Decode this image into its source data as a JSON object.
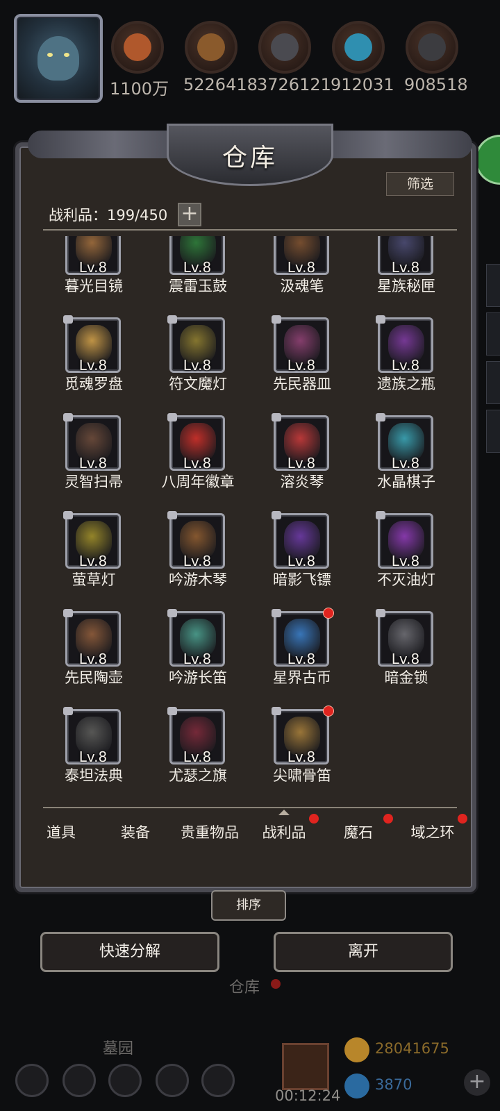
{
  "resources": [
    {
      "icon": "ore-icon",
      "amount": "1100万",
      "color": "#b0582c"
    },
    {
      "icon": "wood-icon",
      "amount": "5226418",
      "color": "#8a5a2c"
    },
    {
      "icon": "iron-icon",
      "amount": "3726121",
      "color": "#4a4a50"
    },
    {
      "icon": "crystal-icon",
      "amount": "912031",
      "color": "#2f8fb0"
    },
    {
      "icon": "steel-icon",
      "amount": "908518",
      "color": "#3c3c40"
    }
  ],
  "panel": {
    "title": "仓库",
    "filter_label": "筛选",
    "loot_label": "战利品：199/450",
    "plus_label": "+"
  },
  "items": [
    {
      "name": "暮光目镜",
      "level": "Lv.8",
      "color": "#9a6a3c",
      "dot": false
    },
    {
      "name": "震雷玉鼓",
      "level": "Lv.8",
      "color": "#2f7a3a",
      "dot": false
    },
    {
      "name": "汲魂笔",
      "level": "Lv.8",
      "color": "#7a5030",
      "dot": false
    },
    {
      "name": "星族秘匣",
      "level": "Lv.8",
      "color": "#4a4a70",
      "dot": false
    },
    {
      "name": "觅魂罗盘",
      "level": "Lv.8",
      "color": "#c89a48",
      "dot": false
    },
    {
      "name": "符文魔灯",
      "level": "Lv.8",
      "color": "#8a7a30",
      "dot": false
    },
    {
      "name": "先民器皿",
      "level": "Lv.8",
      "color": "#8a4070",
      "dot": false
    },
    {
      "name": "遗族之瓶",
      "level": "Lv.8",
      "color": "#7a3a9a",
      "dot": false
    },
    {
      "name": "灵智扫帚",
      "level": "Lv.8",
      "color": "#6a4a3a",
      "dot": false
    },
    {
      "name": "八周年徽章",
      "level": "Lv.8",
      "color": "#c8302a",
      "dot": false
    },
    {
      "name": "溶炎琴",
      "level": "Lv.8",
      "color": "#c03a3a",
      "dot": false
    },
    {
      "name": "水晶棋子",
      "level": "Lv.8",
      "color": "#3aa0b0",
      "dot": false
    },
    {
      "name": "萤草灯",
      "level": "Lv.8",
      "color": "#9a8a2a",
      "dot": false
    },
    {
      "name": "吟游木琴",
      "level": "Lv.8",
      "color": "#8a5a30",
      "dot": false
    },
    {
      "name": "暗影飞镖",
      "level": "Lv.8",
      "color": "#6a3aa0",
      "dot": false
    },
    {
      "name": "不灭油灯",
      "level": "Lv.8",
      "color": "#8a3ab0",
      "dot": false
    },
    {
      "name": "先民陶壶",
      "level": "Lv.8",
      "color": "#8a5a3a",
      "dot": false
    },
    {
      "name": "吟游长笛",
      "level": "Lv.8",
      "color": "#4a9a8a",
      "dot": false
    },
    {
      "name": "星界古币",
      "level": "Lv.8",
      "color": "#3a7ac0",
      "dot": true
    },
    {
      "name": "暗金锁",
      "level": "Lv.8",
      "color": "#6a6a70",
      "dot": false
    },
    {
      "name": "泰坦法典",
      "level": "Lv.8",
      "color": "#5a5a58",
      "dot": false
    },
    {
      "name": "尤瑟之旗",
      "level": "Lv.8",
      "color": "#7a2a3a",
      "dot": false
    },
    {
      "name": "尖啸骨笛",
      "level": "Lv.8",
      "color": "#a07a3a",
      "dot": true
    }
  ],
  "tabs": [
    {
      "label": "道具",
      "dot": false,
      "active": false
    },
    {
      "label": "装备",
      "dot": false,
      "active": false
    },
    {
      "label": "贵重物品",
      "dot": false,
      "active": false
    },
    {
      "label": "战利品",
      "dot": true,
      "active": true
    },
    {
      "label": "魔石",
      "dot": true,
      "active": false
    },
    {
      "label": "域之环",
      "dot": true,
      "active": false
    }
  ],
  "buttons": {
    "sort": "排序",
    "quick_decompose": "快速分解",
    "leave": "离开"
  },
  "hud": {
    "warehouse_label": "仓库",
    "cemetery_label": "墓园",
    "timer": "00:12:24",
    "gold": "28041675",
    "gems": "3870"
  }
}
